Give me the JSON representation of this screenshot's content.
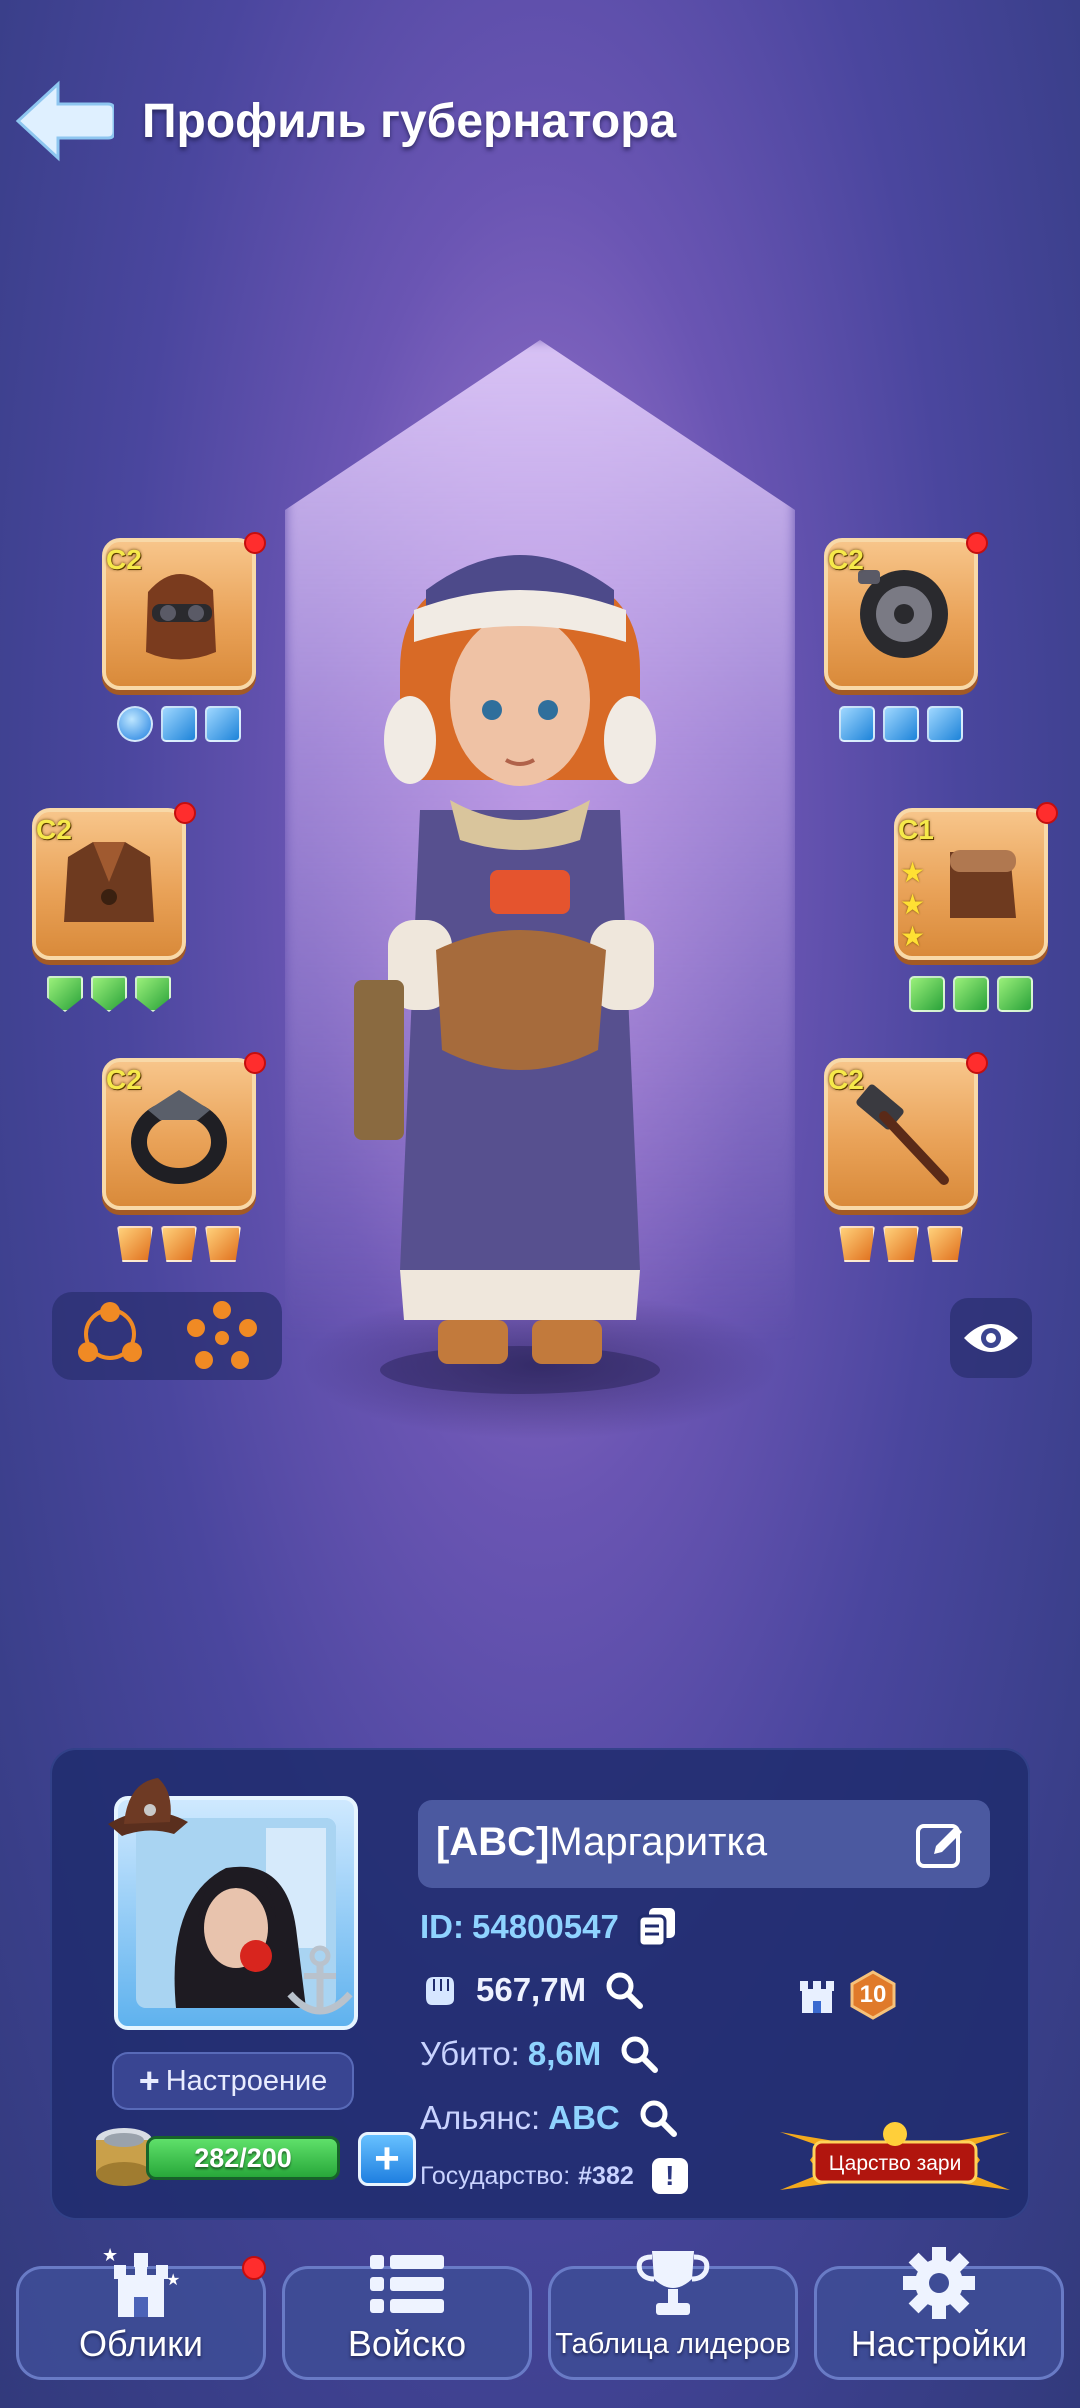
{
  "header": {
    "title": "Профиль губернатора"
  },
  "gear": {
    "left": [
      {
        "tier": "C2",
        "item": "aviator-helmet",
        "gems": [
          "blue-round",
          "blue",
          "blue"
        ]
      },
      {
        "tier": "C2",
        "item": "leather-jacket",
        "gems": [
          "green",
          "green",
          "green"
        ]
      },
      {
        "tier": "C2",
        "item": "ring",
        "gems": [
          "orange",
          "orange",
          "orange"
        ]
      }
    ],
    "right": [
      {
        "tier": "C2",
        "item": "wheel",
        "gems": [
          "blue",
          "blue",
          "blue"
        ]
      },
      {
        "tier": "C1",
        "item": "gloves",
        "stars": 3,
        "gems": [
          "green-sq",
          "green-sq",
          "green-sq"
        ]
      },
      {
        "tier": "C2",
        "item": "hammer",
        "gems": [
          "orange",
          "orange",
          "orange"
        ]
      }
    ]
  },
  "profile": {
    "name_tag": "[ABC]",
    "name": "Маргаритка",
    "id_label": "ID:",
    "id_value": "54800547",
    "power": "567,7M",
    "castle_level": "10",
    "kills_label": "Убито:",
    "kills_value": "8,6M",
    "alliance_label": "Альянс:",
    "alliance_value": "ABC",
    "state_label": "Государство:",
    "state_value": "#382",
    "kingdom_badge": "Царство зари",
    "mood_button": "Настроение",
    "stamina": "282/200"
  },
  "nav": [
    {
      "label": "Облики",
      "icon": "castle-icon",
      "has_dot": true
    },
    {
      "label": "Войско",
      "icon": "list-icon"
    },
    {
      "label": "Таблица лидеров",
      "icon": "trophy-icon"
    },
    {
      "label": "Настройки",
      "icon": "gear-icon"
    }
  ],
  "colors": {
    "accent": "#8fd3ff",
    "card_bg": "#202c6e",
    "notification": "#ff2d2d",
    "stamina": "#28a83a"
  }
}
